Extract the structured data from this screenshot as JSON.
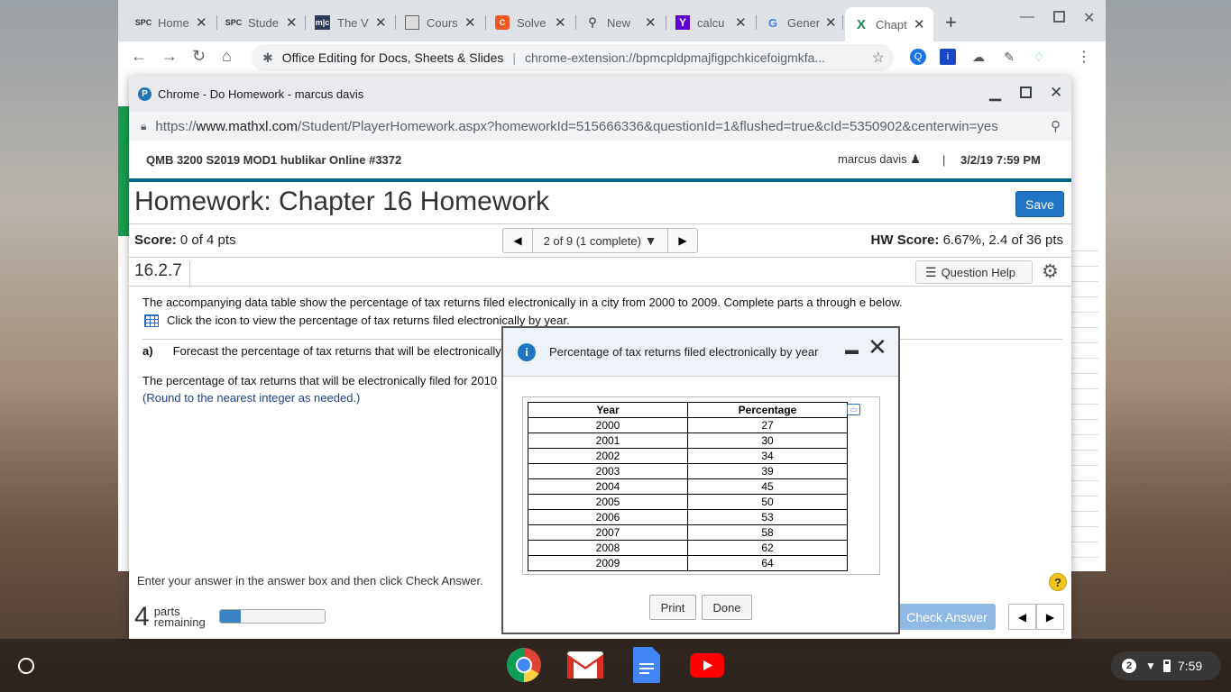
{
  "browser": {
    "tabs": [
      {
        "label": "Home",
        "favicon": "SPC"
      },
      {
        "label": "Stude",
        "favicon": "SPC"
      },
      {
        "label": "The V",
        "favicon": "m|c"
      },
      {
        "label": "Cours",
        "favicon": "page-icon"
      },
      {
        "label": "Solve",
        "favicon": "C"
      },
      {
        "label": "New",
        "favicon": "search-icon"
      },
      {
        "label": "calcu",
        "favicon": "Y"
      },
      {
        "label": "Gener",
        "favicon": "G"
      },
      {
        "label": "Chapt",
        "favicon": "X"
      }
    ],
    "omnibox": {
      "extension_name": "Office Editing for Docs, Sheets & Slides",
      "url": "chrome-extension://bpmcpldpmajfigpchkicefoigmkfa..."
    }
  },
  "popup": {
    "title": "Chrome - Do Homework - marcus davis",
    "url_prefix": "https://",
    "url_domain": "www.mathxl.com",
    "url_path": "/Student/PlayerHomework.aspx?homeworkId=515666336&questionId=1&flushed=true&cId=5350902&centerwin=yes"
  },
  "mathxl": {
    "course": "QMB 3200 S2019 MOD1 hublikar Online #3372",
    "user": "marcus davis",
    "datetime": "3/2/19 7:59 PM",
    "hw_title": "Homework: Chapter 16 Homework",
    "save_label": "Save",
    "score_label": "Score:",
    "score_value": "0 of 4 pts",
    "nav_position": "2 of 9 (1 complete)",
    "hw_score_label": "HW Score:",
    "hw_score_value": "6.67%, 2.4 of 36 pts",
    "question_number": "16.2.7",
    "question_help_label": "Question Help",
    "question_text": "The accompanying data table show the percentage of tax returns filed electronically in a city from 2000 to 2009. Complete parts a through e below.",
    "icon_instruction": "Click the icon to view the percentage of tax returns filed electronically by year.",
    "part_label": "a)",
    "part_a_text": "Forecast the percentage of tax returns that will be electronically",
    "answer_text": "The percentage of tax returns that will be electronically filed for 2010",
    "round_note": "(Round to the nearest integer as needed.)",
    "bottom_help": "Enter your answer in the answer box and then click Check Answer.",
    "parts_count": "4",
    "parts_label_1": "parts",
    "parts_label_2": "remaining",
    "progress_fraction": 0.2,
    "check_answer_label": "Check Answer"
  },
  "dialog": {
    "title": "Percentage of tax returns filed electronically by year",
    "col_year": "Year",
    "col_pct": "Percentage",
    "rows": [
      [
        "2000",
        "27"
      ],
      [
        "2001",
        "30"
      ],
      [
        "2002",
        "34"
      ],
      [
        "2003",
        "39"
      ],
      [
        "2004",
        "45"
      ],
      [
        "2005",
        "50"
      ],
      [
        "2006",
        "53"
      ],
      [
        "2007",
        "58"
      ],
      [
        "2008",
        "62"
      ],
      [
        "2009",
        "64"
      ]
    ],
    "print_label": "Print",
    "done_label": "Done"
  },
  "shelf": {
    "apps": [
      "chrome-icon",
      "gmail-icon",
      "docs-icon",
      "youtube-icon"
    ],
    "notification_count": "2",
    "time": "7:59"
  }
}
